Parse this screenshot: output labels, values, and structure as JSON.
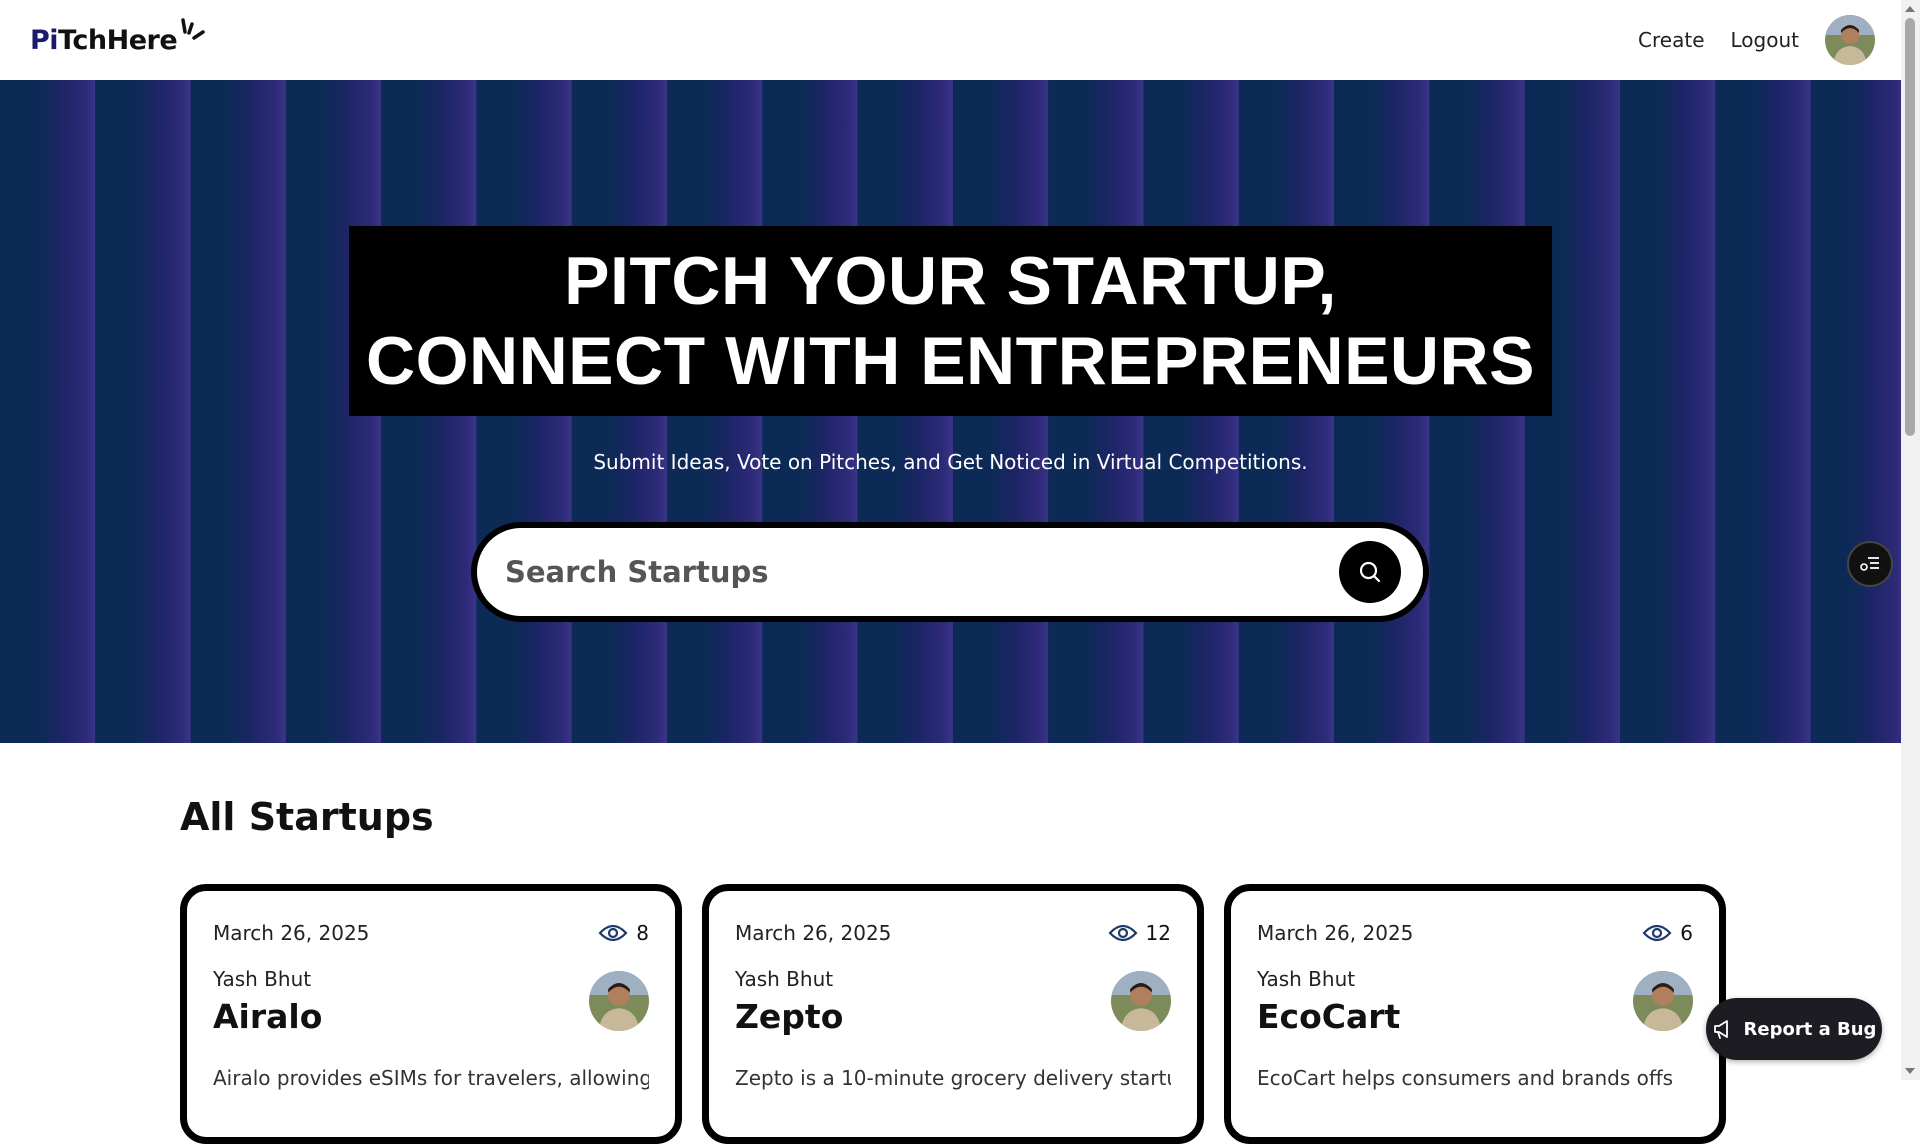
{
  "navbar": {
    "logo_prefix": "Pi",
    "logo_rest": "TchHere",
    "links": {
      "create": "Create",
      "logout": "Logout"
    },
    "avatar_icon": "user-avatar"
  },
  "hero": {
    "title_line1": "PITCH YOUR STARTUP,",
    "title_line2": "CONNECT WITH ENTREPRENEURS",
    "subtitle": "Submit Ideas, Vote on Pitches, and Get Noticed in Virtual Competitions.",
    "search": {
      "placeholder": "Search Startups",
      "value": "",
      "icon": "search-icon"
    }
  },
  "startups_section": {
    "title": "All Startups",
    "cards": [
      {
        "date": "March 26, 2025",
        "views": "8",
        "author": "Yash Bhut",
        "name": "Airalo",
        "description": "Airalo provides eSIMs for travelers, allowing t"
      },
      {
        "date": "March 26, 2025",
        "views": "12",
        "author": "Yash Bhut",
        "name": "Zepto",
        "description": "Zepto is a 10-minute grocery delivery startu"
      },
      {
        "date": "March 26, 2025",
        "views": "6",
        "author": "Yash Bhut",
        "name": "EcoCart",
        "description": "EcoCart helps consumers and brands offs"
      }
    ]
  },
  "report_bug": {
    "label": "Report a Bug",
    "icon": "megaphone-icon"
  },
  "colors": {
    "hero_dark": "#0c2a55",
    "hero_purple": "#3a3488",
    "black": "#000000"
  }
}
